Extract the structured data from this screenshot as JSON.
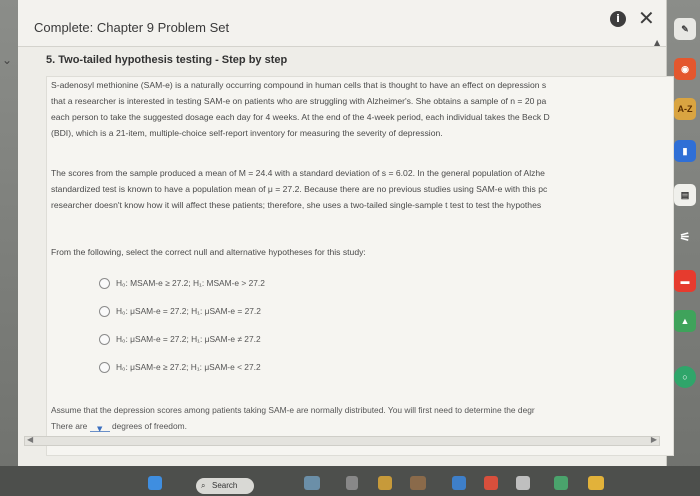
{
  "window": {
    "title": "Complete: Chapter 9 Problem Set",
    "info_icon": "i",
    "close_icon": "✕"
  },
  "question": {
    "heading": "5. Two-tailed hypothesis testing - Step by step",
    "paragraph1": [
      "S-adenosyl methionine (SAM-e) is a naturally occurring compound in human cells that is thought to have an effect on depression s",
      "that a researcher is interested in testing SAM-e on patients who are struggling with Alzheimer's. She obtains a sample of n = 20 pa",
      "each person to take the suggested dosage each day for 4 weeks. At the end of the 4-week period, each individual takes the Beck D",
      "(BDI), which is a 21-item, multiple-choice self-report inventory for measuring the severity of depression."
    ],
    "paragraph2": [
      "The scores from the sample produced a mean of M = 24.4 with a standard deviation of s = 6.02. In the general population of Alzhe",
      "standardized test is known to have a population mean of μ = 27.2. Because there are no previous studies using SAM-e with this pc",
      "researcher doesn't know how it will affect these patients; therefore, she uses a two-tailed single-sample t test to test the hypothes"
    ],
    "prompt": "From the following, select the correct null and alternative hypotheses for this study:",
    "options": [
      "H₀: MSAM-e ≥ 27.2; H₁: MSAM-e > 27.2",
      "H₀: μSAM-e = 27.2; H₁: μSAM-e = 27.2",
      "H₀: μSAM-e = 27.2; H₁: μSAM-e ≠ 27.2",
      "H₀: μSAM-e ≥ 27.2; H₁: μSAM-e < 27.2"
    ],
    "assume_line1": "Assume that the depression scores among patients taking SAM-e are normally distributed. You will first need to determine the degr",
    "assume_before": "There are",
    "assume_after": "degrees of freedom.",
    "dropdown_arrow": "▼"
  },
  "right_rail": {
    "az_label": "A-Z"
  },
  "taskbar": {
    "search_label": "Search",
    "search_icon": "⌕"
  },
  "colors": {
    "panel": "#eeede8",
    "accent": "#3b6fc0",
    "taskbar": "#4d4f4c"
  }
}
